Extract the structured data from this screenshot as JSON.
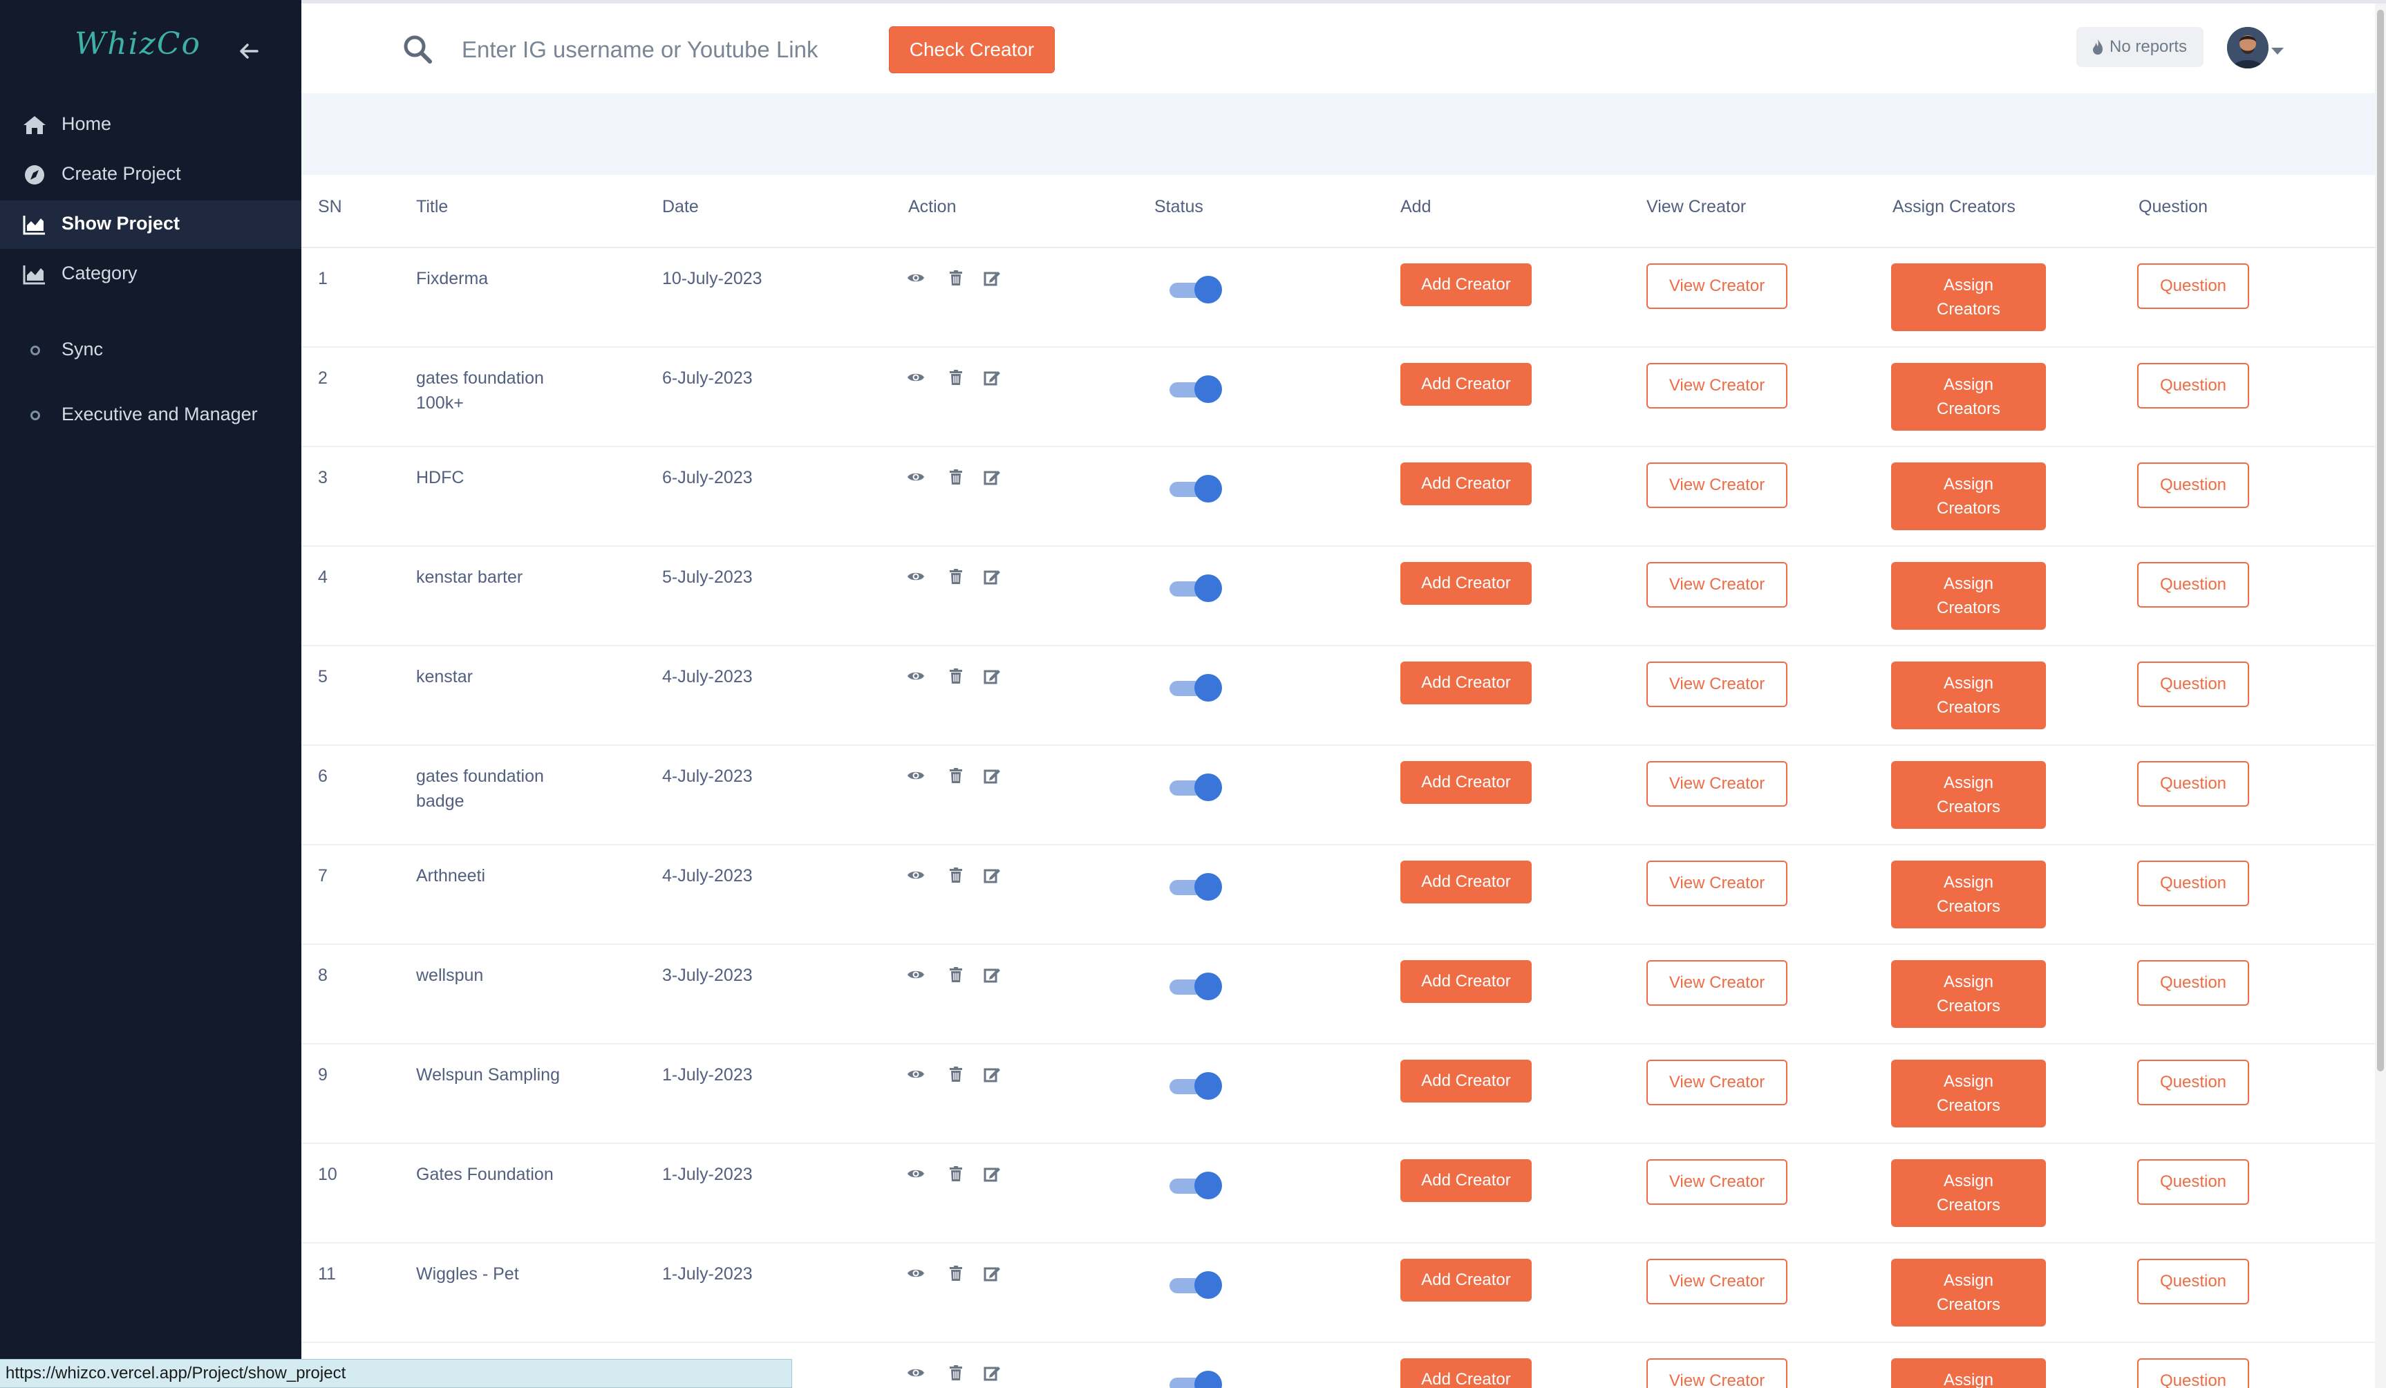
{
  "brand": "WhizCo",
  "sidebar": {
    "items": [
      {
        "label": "Home",
        "icon": "home-icon",
        "active": false
      },
      {
        "label": "Create Project",
        "icon": "compass-icon",
        "active": false
      },
      {
        "label": "Show Project",
        "icon": "chart-icon",
        "active": true
      },
      {
        "label": "Category",
        "icon": "chart-icon",
        "active": false
      },
      {
        "label": "Sync",
        "icon": "circle-icon",
        "active": false
      },
      {
        "label": "Executive and Manager",
        "icon": "circle-icon",
        "active": false
      }
    ]
  },
  "search": {
    "placeholder": "Enter IG username or Youtube Link",
    "value": "",
    "button_label": "Check Creator"
  },
  "header": {
    "reports_label": "No reports"
  },
  "table": {
    "columns": [
      "SN",
      "Title",
      "Date",
      "Action",
      "Status",
      "Add",
      "View Creator",
      "Assign Creators",
      "Question"
    ],
    "button_labels": {
      "add": "Add Creator",
      "view": "View Creator",
      "assign": "Assign Creators",
      "question": "Question"
    },
    "rows": [
      {
        "sn": "1",
        "title": "Fixderma",
        "date": "10-July-2023",
        "status": true
      },
      {
        "sn": "2",
        "title": "gates foundation 100k+",
        "date": "6-July-2023",
        "status": true
      },
      {
        "sn": "3",
        "title": "HDFC",
        "date": "6-July-2023",
        "status": true
      },
      {
        "sn": "4",
        "title": "kenstar barter",
        "date": "5-July-2023",
        "status": true
      },
      {
        "sn": "5",
        "title": "kenstar",
        "date": "4-July-2023",
        "status": true
      },
      {
        "sn": "6",
        "title": "gates foundation badge",
        "date": "4-July-2023",
        "status": true
      },
      {
        "sn": "7",
        "title": "Arthneeti",
        "date": "4-July-2023",
        "status": true
      },
      {
        "sn": "8",
        "title": "wellspun",
        "date": "3-July-2023",
        "status": true
      },
      {
        "sn": "9",
        "title": "Welspun Sampling",
        "date": "1-July-2023",
        "status": true
      },
      {
        "sn": "10",
        "title": "Gates Foundation",
        "date": "1-July-2023",
        "status": true
      },
      {
        "sn": "11",
        "title": "Wiggles - Pet",
        "date": "1-July-2023",
        "status": true
      },
      {
        "sn": "",
        "title": "",
        "date": "",
        "status": true
      }
    ]
  },
  "statusbar": {
    "url": "https://whizco.vercel.app/Project/show_project"
  },
  "colors": {
    "sidebar_bg": "#121a2c",
    "accent": "#ef6c45",
    "toggle_on": "#3a75d9"
  }
}
